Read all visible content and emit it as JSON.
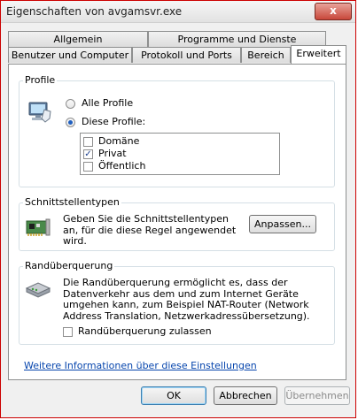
{
  "window": {
    "title": "Eigenschaften von avgamsvr.exe",
    "close_glyph": "x"
  },
  "tabs": {
    "back_row": [
      "Allgemein",
      "Programme und Dienste"
    ],
    "front_row": [
      "Benutzer und Computer",
      "Protokoll und Ports",
      "Bereich",
      "Erweitert"
    ],
    "active": "Erweitert"
  },
  "profile": {
    "legend": "Profile",
    "icon": "computer-shield-icon",
    "options": [
      {
        "label": "Alle Profile",
        "selected": false
      },
      {
        "label": "Diese Profile:",
        "selected": true
      }
    ],
    "list": [
      {
        "label": "Domäne",
        "checked": false
      },
      {
        "label": "Privat",
        "checked": true
      },
      {
        "label": "Öffentlich",
        "checked": false
      }
    ]
  },
  "interfaces": {
    "legend": "Schnittstellentypen",
    "icon": "network-card-icon",
    "text": "Geben Sie die Schnittstellentypen an, für die diese Regel angewendet wird.",
    "button": "Anpassen..."
  },
  "edge": {
    "legend": "Randüberquerung",
    "icon": "network-router-icon",
    "text": "Die Randüberquerung ermöglicht es, dass der Datenverkehr aus dem und zum Internet Geräte umgehen kann, zum Beispiel NAT-Router (Network Address Translation, Netzwerkadressübersetzung).",
    "checkbox_label": "Randüberquerung zulassen",
    "checkbox_checked": false
  },
  "link": "Weitere Informationen über diese Einstellungen",
  "footer": {
    "ok": "OK",
    "cancel": "Abbrechen",
    "apply": "Übernehmen"
  }
}
